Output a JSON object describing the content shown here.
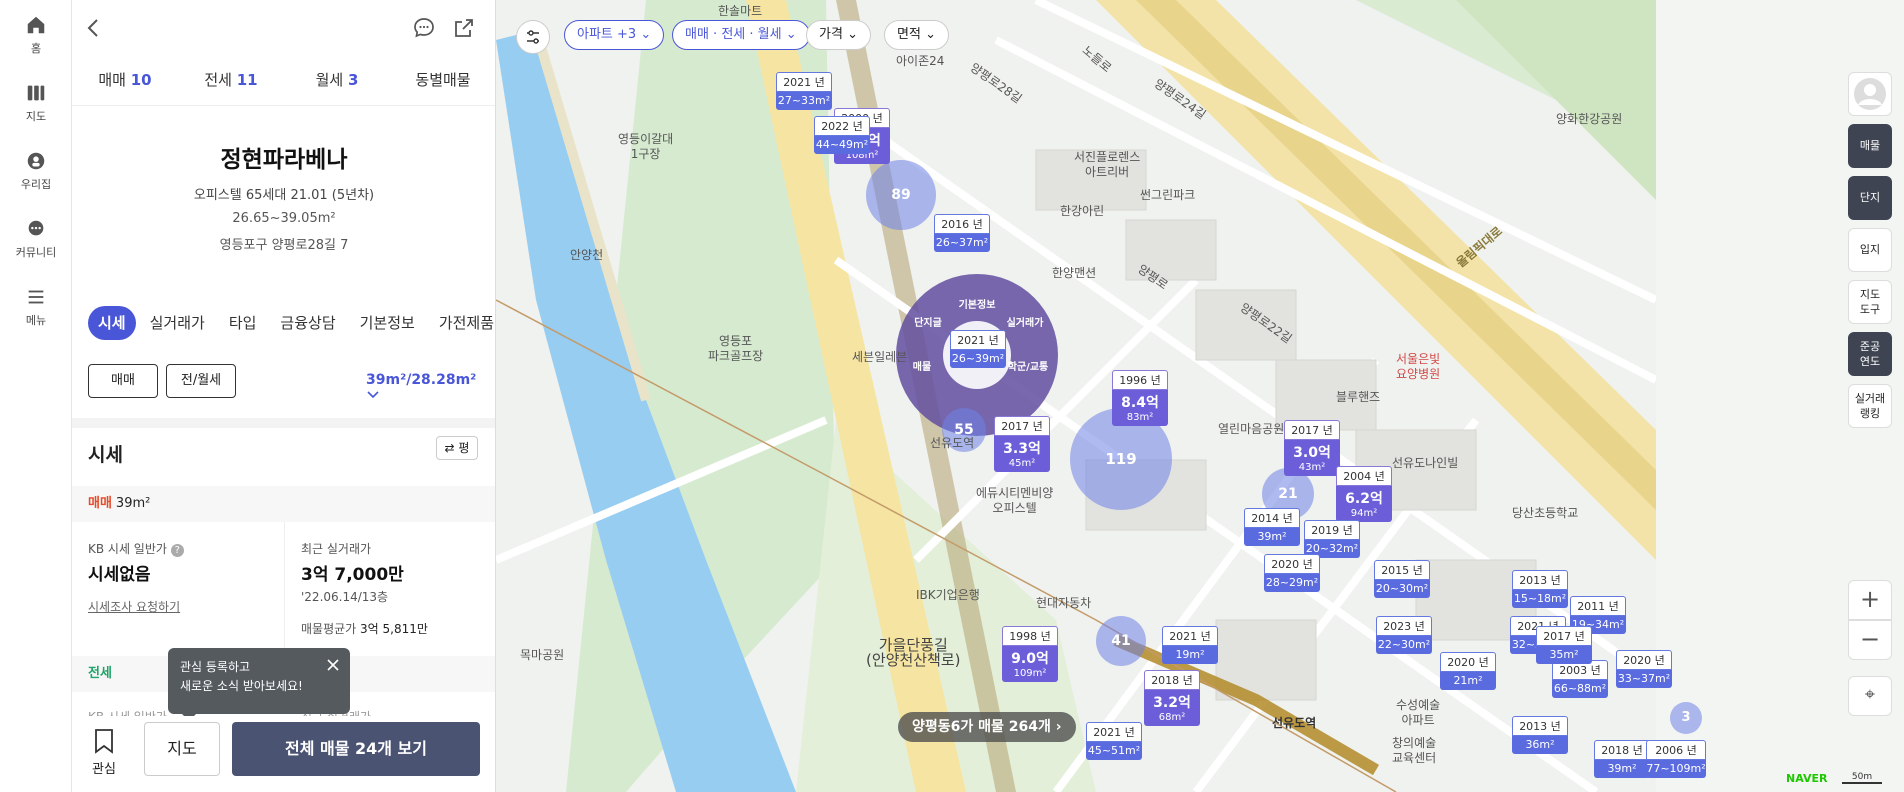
{
  "nav": [
    {
      "label": "홈",
      "icon": "home-icon"
    },
    {
      "label": "지도",
      "icon": "map-icon"
    },
    {
      "label": "우리집",
      "icon": "my-home-icon"
    },
    {
      "label": "커뮤니티",
      "icon": "community-icon"
    },
    {
      "label": "메뉴",
      "icon": "menu-icon"
    }
  ],
  "panel": {
    "type_tabs": [
      {
        "label": "매매",
        "count": "10"
      },
      {
        "label": "전세",
        "count": "11"
      },
      {
        "label": "월세",
        "count": "3"
      },
      {
        "label": "동별매물",
        "count": ""
      }
    ],
    "complex": {
      "name": "정현파라베나",
      "info_line": "오피스텔  65세대  21.01 (5년차)",
      "area_range": "26.65~39.05m²",
      "address": "영등포구 양평로28길 7"
    },
    "info_tabs": [
      "시세",
      "실거래가",
      "타입",
      "금융상담",
      "기본정보",
      "가전제품"
    ],
    "trade_buttons": [
      "매매",
      "전/월세"
    ],
    "area_select": "39m²/28.28m²",
    "sise": {
      "heading": "시세",
      "unit_button": "평",
      "sale_label": "매매",
      "sale_area": "39m²",
      "kb_label": "KB 시세 일반가",
      "kb_value": "시세없음",
      "kb_link": "시세조사 요청하기",
      "recent_label": "최근 실거래가",
      "recent_value": "3억 7,000만",
      "recent_date": "'22.06.14/13층",
      "avg_label": "매물평균가",
      "avg_value": "3억 5,811만",
      "jeonse_label": "전세",
      "kb_label2": "KB 시세 일반가",
      "recent_label2": "최근 실거래가"
    },
    "toast": {
      "line1": "관심 등록하고",
      "line2": "새로운 소식 받아보세요!"
    },
    "bottom": {
      "fav": "관심",
      "map": "지도",
      "all": "전체 매물 24개 보기"
    }
  },
  "map": {
    "chips": [
      "아파트 +3",
      "매매 · 전세 · 월세",
      "가격",
      "면적"
    ],
    "count_pill": "양평동6가 매물 264개",
    "right_tools": [
      "매물",
      "단지",
      "입지",
      "지도\n도구",
      "준공\n연도",
      "실거래\n랭킹"
    ],
    "radial_menu": [
      "기본정보",
      "단지글",
      "실거래가",
      "매물",
      "학군/교통"
    ],
    "pins": [
      {
        "year": "2000 년",
        "price": "8.7억",
        "area": "108m²"
      },
      {
        "year": "1996 년",
        "price": "8.4억",
        "area": "83m²"
      },
      {
        "year": "2017 년",
        "price": "3.3억",
        "area": "45m²"
      },
      {
        "year": "2017 년",
        "price": "3.0억",
        "area": "43m²"
      },
      {
        "year": "2004 년",
        "price": "6.2억",
        "area": "94m²"
      },
      {
        "year": "1998 년",
        "price": "9.0억",
        "area": "109m²"
      },
      {
        "year": "2018 년",
        "price": "3.2억",
        "area": "68m²"
      }
    ],
    "small_pins": [
      {
        "year": "2021 년",
        "area": "27~33m²"
      },
      {
        "year": "2022 년",
        "area": "44~49m²"
      },
      {
        "year": "2016 년",
        "area": "26~37m²"
      },
      {
        "year": "2021 년",
        "area": "26~39m²"
      },
      {
        "year": "2014 년",
        "area": "39m²"
      },
      {
        "year": "2019 년",
        "area": "20~32m²"
      },
      {
        "year": "2020 년",
        "area": "28~29m²"
      },
      {
        "year": "2015 년",
        "area": "20~30m²"
      },
      {
        "year": "2011 년",
        "area": "19~34m²"
      },
      {
        "year": "2021 년",
        "area": "19m²"
      },
      {
        "year": "2021 년",
        "area": "45~51m²"
      },
      {
        "year": "2023 년",
        "area": "22~30m²"
      },
      {
        "year": "2020 년",
        "area": "21m²"
      },
      {
        "year": "2003 년",
        "area": "66~88m²"
      },
      {
        "year": "2020 년",
        "area": "33~37m²"
      },
      {
        "year": "2013 년",
        "area": "36m²"
      },
      {
        "year": "2018 년",
        "area": "39m²"
      },
      {
        "year": "2006 년",
        "area": "77~109m²"
      },
      {
        "year": "2021 년",
        "area": "32~36m²"
      },
      {
        "year": "2017 년",
        "area": "35m²"
      },
      {
        "year": "2013 년",
        "area": "15~18m²"
      }
    ],
    "clusters": [
      "89",
      "55",
      "119",
      "21",
      "41",
      "3"
    ],
    "labels": [
      "양화한강공원",
      "서진플로렌스\n아트리버",
      "썬그린파크",
      "한강아린",
      "한양맨션",
      "영등이갈대\n1구장",
      "안양천",
      "영등포\n파크골프장",
      "세븐일레븐",
      "선유도역",
      "에듀시티멘비양\n오피스텔",
      "열린마음공원",
      "선유도나인빌",
      "서울은빛\n요양병원",
      "블루핸즈",
      "IBK기업은행",
      "현대자동차",
      "가을단풍길\n(안양천산책로)",
      "목마공원",
      "수성예술\n아파트",
      "창의예술\n교육센터",
      "선유도역",
      "당산초등학교",
      "올림픽대로",
      "노들로",
      "양평로",
      "양평로22길",
      "양평로24길",
      "양평로28길",
      "한솔마트",
      "아이존24"
    ],
    "brand": "NAVER",
    "scale": "50m"
  },
  "colors": {
    "accent": "#4a56d8",
    "pin": "#6c5ed9",
    "cluster": "#7b8ee8",
    "road": "#f7e6a8",
    "river": "#8ec6f0",
    "park": "#cfe5c2"
  }
}
